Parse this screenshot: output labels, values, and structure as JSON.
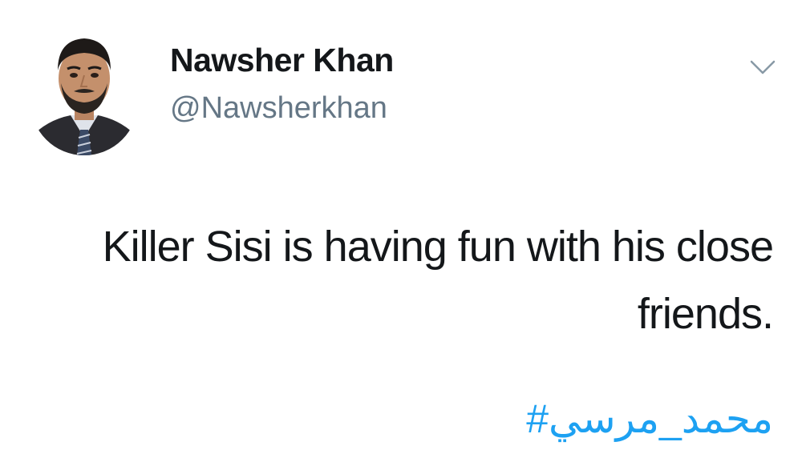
{
  "tweet": {
    "author": {
      "display_name": "Nawsher Khan",
      "handle": "@Nawsherkhan",
      "avatar_icon": "profile-photo"
    },
    "menu_icon": "chevron-down-icon",
    "text": "Killer Sisi is having fun with his close friends.",
    "hashtag": "#محمد_مرسي"
  },
  "colors": {
    "text": "#14171a",
    "secondary": "#657786",
    "link": "#1da1f2",
    "background": "#ffffff"
  }
}
